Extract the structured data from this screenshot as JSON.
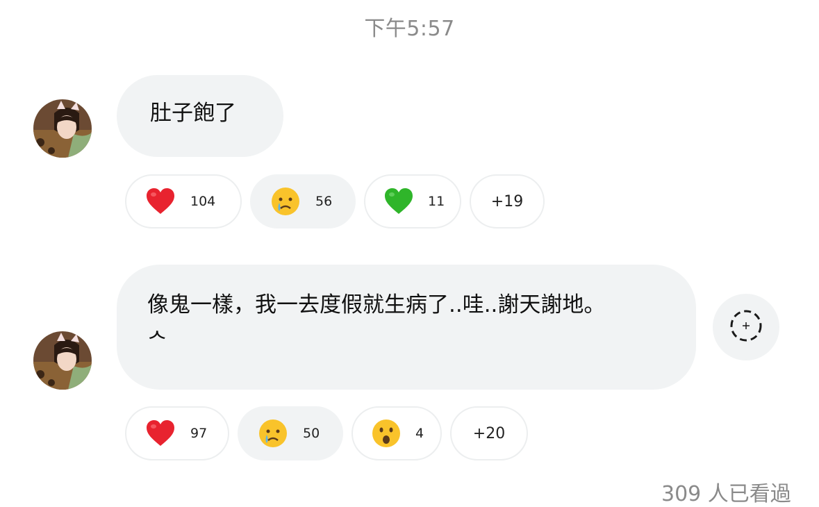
{
  "timestamp": "下午5:57",
  "colors": {
    "bubble_bg": "#f1f3f4",
    "pill_border": "#eceeef",
    "timestamp_text": "#8a8a8a",
    "heart_red": "#e8232f",
    "heart_green": "#2fb52a"
  },
  "messages": [
    {
      "text": "肚子飽了",
      "reactions": [
        {
          "emoji": "red-heart-icon",
          "count": "104",
          "active": false
        },
        {
          "emoji": "crying-face-icon",
          "count": "56",
          "active": true
        },
        {
          "emoji": "green-heart-icon",
          "count": "11",
          "active": false
        }
      ],
      "more": "+19"
    },
    {
      "text_line1": "像鬼一樣，我一去度假就生病了..哇..謝天謝地。",
      "text_line2": "ᄉ",
      "reactions": [
        {
          "emoji": "red-heart-icon",
          "count": "97",
          "active": false
        },
        {
          "emoji": "crying-face-icon",
          "count": "50",
          "active": true
        },
        {
          "emoji": "surprised-face-icon",
          "count": "4",
          "active": false
        }
      ],
      "more": "+20"
    }
  ],
  "seen_text": "309 人已看過"
}
